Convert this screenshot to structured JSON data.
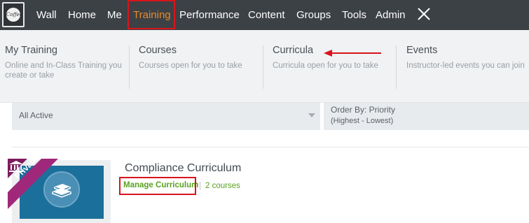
{
  "logo": {
    "text": "Coffee"
  },
  "nav": {
    "items": [
      {
        "label": "Wall"
      },
      {
        "label": "Home"
      },
      {
        "label": "Me"
      },
      {
        "label": "Training"
      },
      {
        "label": "Performance"
      },
      {
        "label": "Content"
      },
      {
        "label": "Groups"
      },
      {
        "label": "Tools"
      },
      {
        "label": "Admin"
      }
    ],
    "active": "Training",
    "close_icon": "close-icon"
  },
  "dropdown": {
    "columns": [
      {
        "title": "My Training",
        "desc": "Online and In-Class Training you create or take"
      },
      {
        "title": "Courses",
        "desc": "Courses open for you to take"
      },
      {
        "title": "Curricula",
        "desc": "Curricula open for you to take"
      },
      {
        "title": "Events",
        "desc": "Instructor-led events you can join"
      }
    ]
  },
  "filters": {
    "status": "All Active",
    "order_line1": "Order By: Priority",
    "order_line2": "(Highest - Lowest)"
  },
  "card": {
    "badge": "Private",
    "badge_icon": "institution-icon",
    "thumb_icon": "books-icon",
    "title": "Compliance Curriculum",
    "manage_label": "Manage Curriculum",
    "separator": "|",
    "courses_label": "2 courses"
  },
  "colors": {
    "nav_bg": "#3c4146",
    "accent": "#e88a2c",
    "highlight": "#d8141b",
    "link": "#5aa120",
    "badge": "#a0287a",
    "thumb_bg": "#1b6f9b"
  }
}
